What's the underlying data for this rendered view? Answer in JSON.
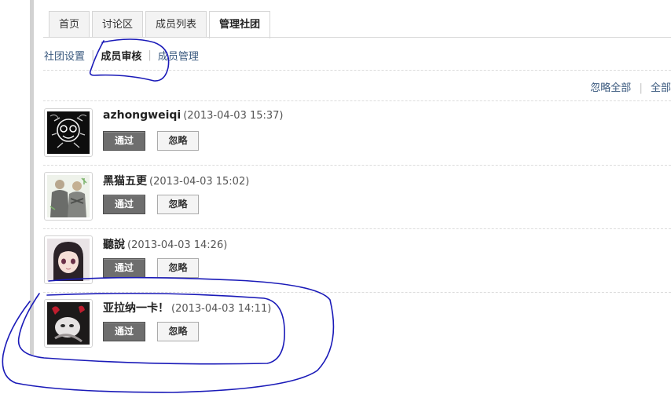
{
  "tabs": [
    {
      "label": "首页"
    },
    {
      "label": "讨论区"
    },
    {
      "label": "成员列表"
    },
    {
      "label": "管理社团"
    }
  ],
  "subnav": {
    "settings": "社团设置",
    "review": "成员审核",
    "members": "成员管理",
    "separator": "|"
  },
  "actions": {
    "ignore_all": "忽略全部",
    "approve_all": "全部",
    "separator": "|"
  },
  "requests": [
    {
      "name": "azhongweiqi",
      "time": "(2013-04-03 15:37)",
      "approve": "通过",
      "ignore": "忽略"
    },
    {
      "name": "黑猫五更",
      "time": "(2013-04-03 15:02)",
      "approve": "通过",
      "ignore": "忽略"
    },
    {
      "name": "聽說",
      "time": "(2013-04-03 14:26)",
      "approve": "通过",
      "ignore": "忽略"
    },
    {
      "name": "亚拉纳一卡！",
      "time": "(2013-04-03 14:11)",
      "approve": "通过",
      "ignore": "忽略"
    }
  ],
  "colors": {
    "link": "#3b5a7f",
    "approve_button": "#6e6e6e",
    "annotation_ink": "#1a1ab8"
  }
}
